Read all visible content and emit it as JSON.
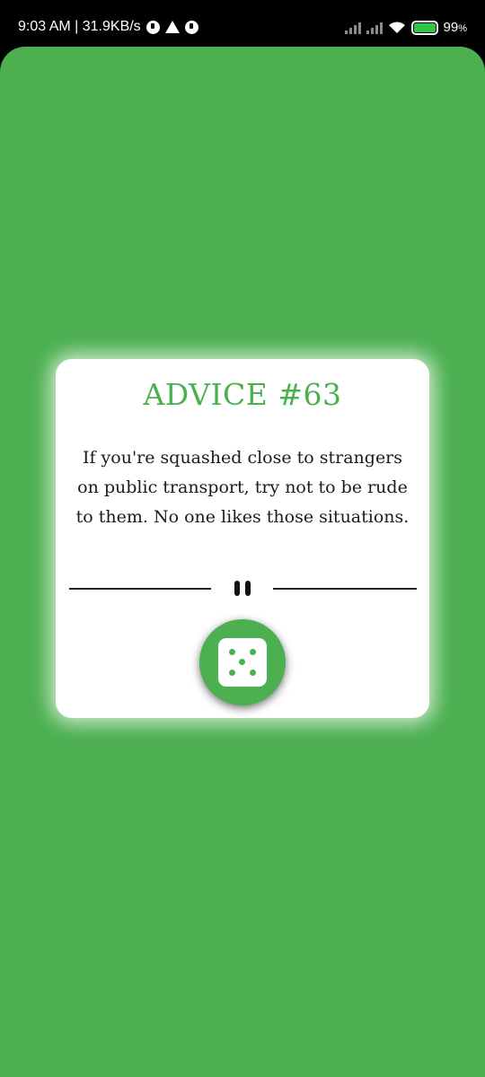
{
  "status_bar": {
    "time_speed": "9:03 AM | 31.9KB/s",
    "battery_percent": "99",
    "battery_unit": "%",
    "battery_level": 0.99,
    "icons": [
      "data-saver-icon",
      "warning-icon",
      "data-saver-icon",
      "signal-icon",
      "signal-icon",
      "wifi-icon",
      "battery-charging-icon"
    ]
  },
  "card": {
    "title": "ADVICE #63",
    "advice_text": "If you're squashed close to strangers on public transport, try not to be rude to them. No one likes those situations."
  },
  "colors": {
    "accent": "#4caf50",
    "card_background": "#ffffff",
    "text": "#1b1b1b"
  },
  "controls": {
    "divider_icon": "pause-icon",
    "roll_button_icon": "dice-icon"
  }
}
